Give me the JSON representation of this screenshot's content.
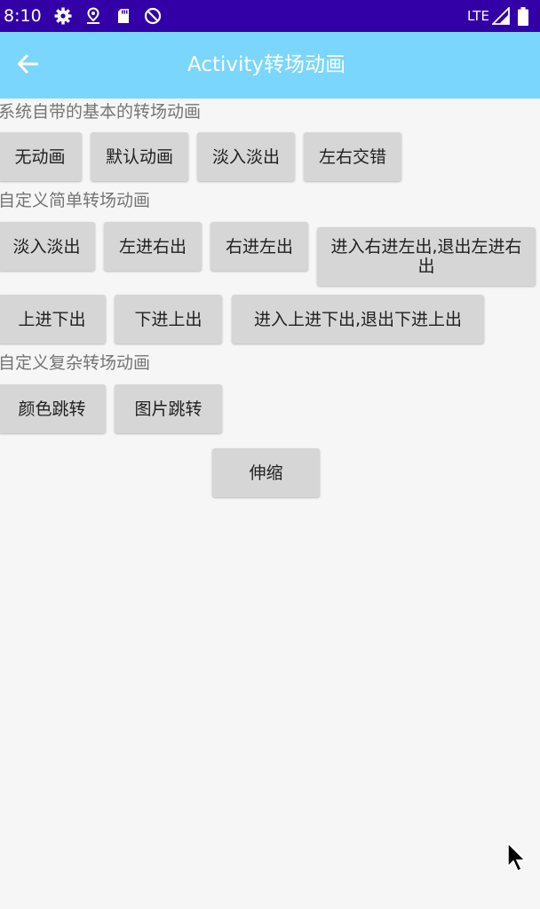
{
  "status_bar": {
    "time": "8:10",
    "network": "LTE",
    "icons": [
      "gear-icon",
      "location-icon",
      "sd-card-icon",
      "no-disturb-icon",
      "signal-icon",
      "battery-icon"
    ],
    "background": "#3300a8"
  },
  "app_bar": {
    "title": "Activity转场动画",
    "back_icon": "arrow-left-icon",
    "background": "#7ad6fd"
  },
  "sections": [
    {
      "label": "系统自带的基本的转场动画",
      "buttons": [
        "无动画",
        "默认动画",
        "淡入淡出",
        "左右交错"
      ]
    },
    {
      "label": "自定义简单转场动画",
      "buttons": [
        "淡入淡出",
        "左进右出",
        "右进左出",
        "进入右进左出,退出左进右出",
        "上进下出",
        "下进上出",
        "进入上进下出,退出下进上出"
      ]
    },
    {
      "label": "自定义复杂转场动画",
      "buttons": [
        "颜色跳转",
        "图片跳转",
        "伸缩"
      ]
    }
  ]
}
